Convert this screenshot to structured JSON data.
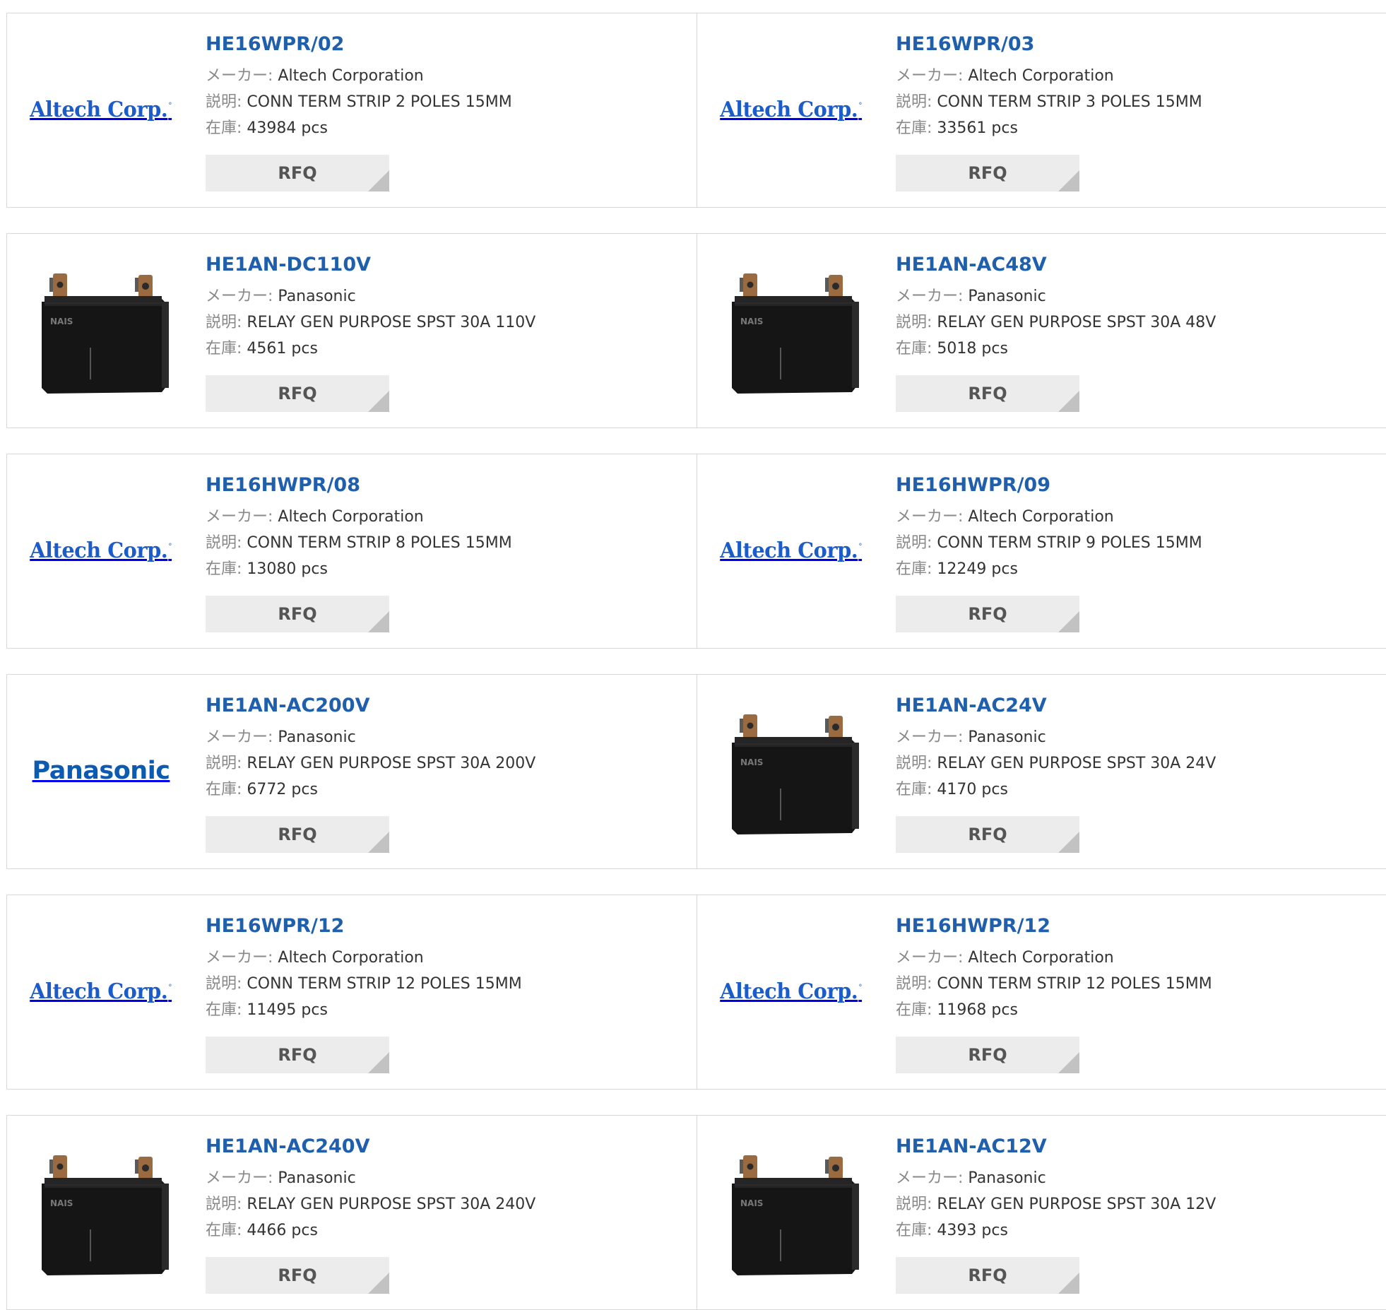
{
  "labels": {
    "maker": "メーカー:",
    "desc": "説明:",
    "stock": "在庫:",
    "rfq": "RFQ"
  },
  "logos": {
    "altech_text": "Altech Corp.",
    "altech_mark": "°",
    "panasonic_text": "Panasonic",
    "relay_brand": "NAIS"
  },
  "products": [
    {
      "part": "HE16WPR/02",
      "maker": "Altech Corporation",
      "desc": "CONN TERM STRIP 2 POLES 15MM",
      "stock": "43984 pcs",
      "image": "altech-logo"
    },
    {
      "part": "HE16WPR/03",
      "maker": "Altech Corporation",
      "desc": "CONN TERM STRIP 3 POLES 15MM",
      "stock": "33561 pcs",
      "image": "altech-logo"
    },
    {
      "part": "HE1AN-DC110V",
      "maker": "Panasonic",
      "desc": "RELAY GEN PURPOSE SPST 30A 110V",
      "stock": "4561 pcs",
      "image": "relay"
    },
    {
      "part": "HE1AN-AC48V",
      "maker": "Panasonic",
      "desc": "RELAY GEN PURPOSE SPST 30A 48V",
      "stock": "5018 pcs",
      "image": "relay"
    },
    {
      "part": "HE16HWPR/08",
      "maker": "Altech Corporation",
      "desc": "CONN TERM STRIP 8 POLES 15MM",
      "stock": "13080 pcs",
      "image": "altech-logo"
    },
    {
      "part": "HE16HWPR/09",
      "maker": "Altech Corporation",
      "desc": "CONN TERM STRIP 9 POLES 15MM",
      "stock": "12249 pcs",
      "image": "altech-logo"
    },
    {
      "part": "HE1AN-AC200V",
      "maker": "Panasonic",
      "desc": "RELAY GEN PURPOSE SPST 30A 200V",
      "stock": "6772 pcs",
      "image": "panasonic-logo"
    },
    {
      "part": "HE1AN-AC24V",
      "maker": "Panasonic",
      "desc": "RELAY GEN PURPOSE SPST 30A 24V",
      "stock": "4170 pcs",
      "image": "relay"
    },
    {
      "part": "HE16WPR/12",
      "maker": "Altech Corporation",
      "desc": "CONN TERM STRIP 12 POLES 15MM",
      "stock": "11495 pcs",
      "image": "altech-logo"
    },
    {
      "part": "HE16HWPR/12",
      "maker": "Altech Corporation",
      "desc": "CONN TERM STRIP 12 POLES 15MM",
      "stock": "11968 pcs",
      "image": "altech-logo"
    },
    {
      "part": "HE1AN-AC240V",
      "maker": "Panasonic",
      "desc": "RELAY GEN PURPOSE SPST 30A 240V",
      "stock": "4466 pcs",
      "image": "relay"
    },
    {
      "part": "HE1AN-AC12V",
      "maker": "Panasonic",
      "desc": "RELAY GEN PURPOSE SPST 30A 12V",
      "stock": "4393 pcs",
      "image": "relay"
    }
  ]
}
